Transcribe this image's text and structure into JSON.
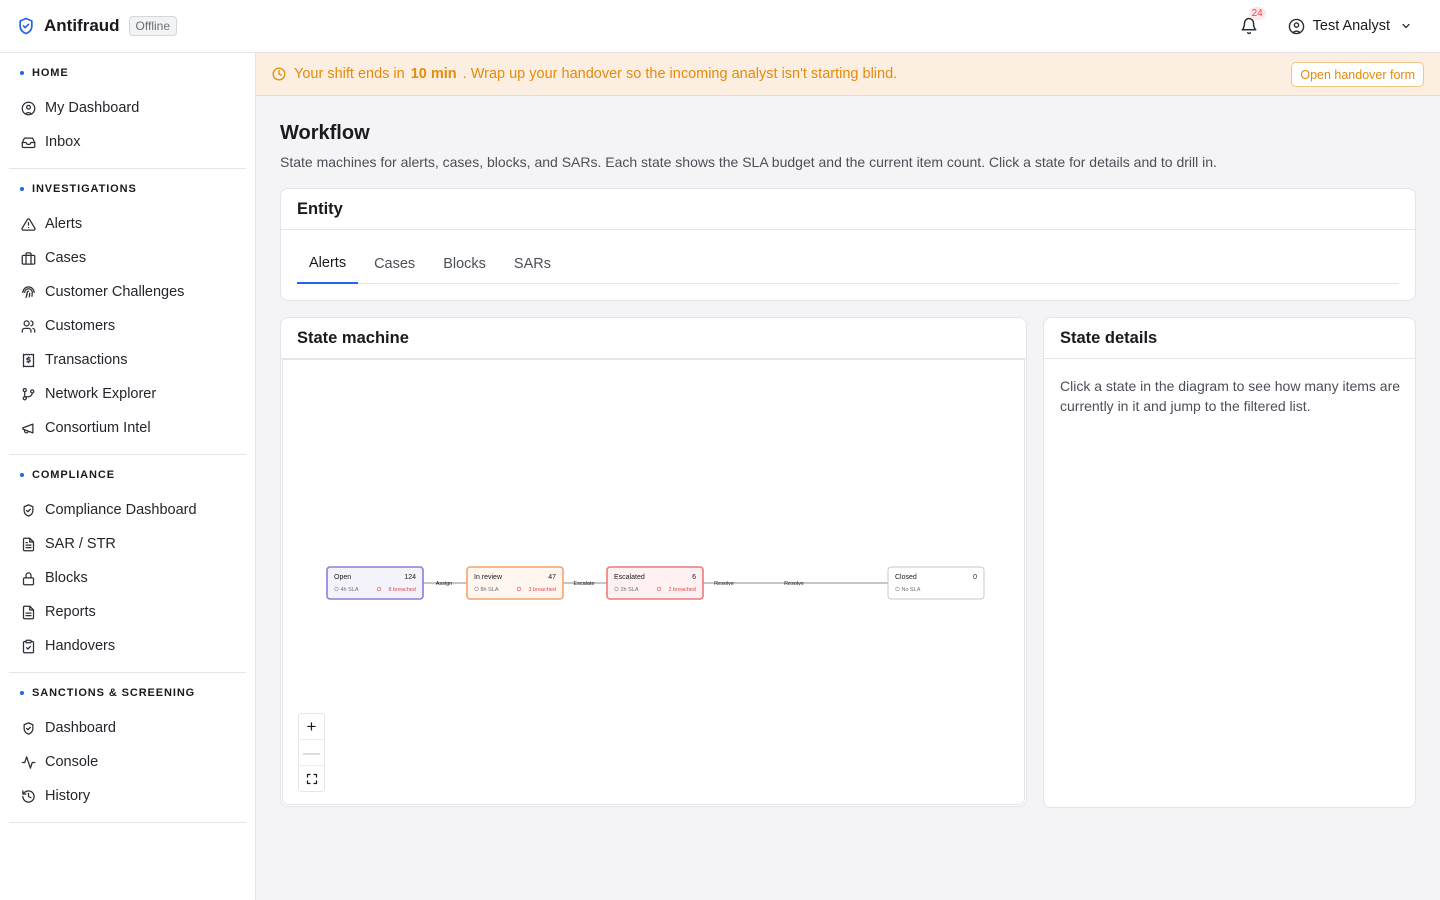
{
  "app": {
    "title": "Antifraud",
    "status": "Offline"
  },
  "topbar": {
    "notification_count": "24",
    "user_name": "Test Analyst"
  },
  "sidebar": {
    "sections": [
      {
        "title": "HOME",
        "items": [
          {
            "label": "My Dashboard",
            "icon": "user-circle-icon"
          },
          {
            "label": "Inbox",
            "icon": "inbox-icon"
          }
        ]
      },
      {
        "title": "INVESTIGATIONS",
        "items": [
          {
            "label": "Alerts",
            "icon": "alert-triangle-icon"
          },
          {
            "label": "Cases",
            "icon": "briefcase-icon"
          },
          {
            "label": "Customer Challenges",
            "icon": "fingerprint-icon"
          },
          {
            "label": "Customers",
            "icon": "users-icon"
          },
          {
            "label": "Transactions",
            "icon": "receipt-dollar-icon"
          },
          {
            "label": "Network Explorer",
            "icon": "git-branch-icon"
          },
          {
            "label": "Consortium Intel",
            "icon": "megaphone-icon"
          }
        ]
      },
      {
        "title": "COMPLIANCE",
        "items": [
          {
            "label": "Compliance Dashboard",
            "icon": "shield-check-icon"
          },
          {
            "label": "SAR / STR",
            "icon": "file-text-icon"
          },
          {
            "label": "Blocks",
            "icon": "lock-icon"
          },
          {
            "label": "Reports",
            "icon": "file-lines-icon"
          },
          {
            "label": "Handovers",
            "icon": "clipboard-check-icon"
          }
        ]
      },
      {
        "title": "SANCTIONS & SCREENING",
        "items": [
          {
            "label": "Dashboard",
            "icon": "shield-check-icon"
          },
          {
            "label": "Console",
            "icon": "activity-icon"
          },
          {
            "label": "History",
            "icon": "history-icon"
          }
        ]
      }
    ]
  },
  "banner": {
    "prefix": "Your shift ends in",
    "time": "10 min",
    "suffix": ". Wrap up your handover so the incoming analyst isn't starting blind.",
    "button": "Open handover form"
  },
  "page": {
    "title": "Workflow",
    "description": "State machines for alerts, cases, blocks, and SARs. Each state shows the SLA budget and the current item count. Click a state for details and to drill in."
  },
  "entity": {
    "title": "Entity",
    "tabs": [
      "Alerts",
      "Cases",
      "Blocks",
      "SARs"
    ],
    "active_tab": "Alerts"
  },
  "state_machine": {
    "title": "State machine",
    "nodes": [
      {
        "name": "Open",
        "count": "124",
        "sla": "4h SLA",
        "breached": "8 breached",
        "color": "#8b7fd8",
        "fill": "#f4f3fc"
      },
      {
        "name": "In review",
        "count": "47",
        "sla": "8h SLA",
        "breached": "3 breached",
        "color": "#f4a46a",
        "fill": "#fff6ef"
      },
      {
        "name": "Escalated",
        "count": "6",
        "sla": "2h SLA",
        "breached": "2 breached",
        "color": "#ec7a7a",
        "fill": "#fff1f1"
      },
      {
        "name": "Closed",
        "count": "0",
        "sla": "No SLA",
        "breached": "",
        "color": "#c8c9cd",
        "fill": "#ffffff"
      }
    ],
    "edges": [
      "Assign",
      "Escalate",
      "Resolve",
      "Resolve"
    ],
    "zoom": {
      "in": "+",
      "out": "—",
      "fit": "fit-view-icon"
    }
  },
  "details": {
    "title": "State details",
    "text": "Click a state in the diagram to see how many items are currently in it and jump to the filtered list."
  },
  "colors": {
    "accent": "#2563eb",
    "warning": "#e58a0a",
    "danger": "#e5484d"
  }
}
